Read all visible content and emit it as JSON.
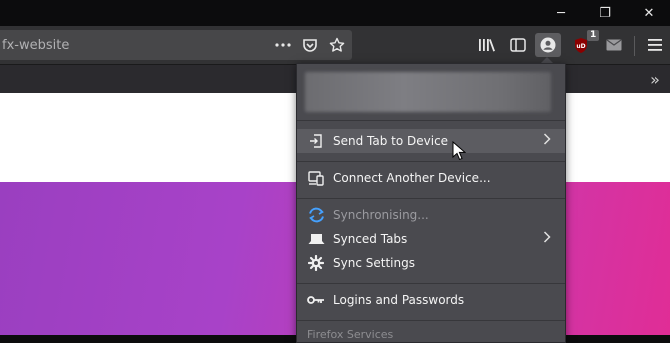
{
  "window": {
    "controls": {
      "minimize": "─",
      "restore": "❐",
      "close": "✕"
    }
  },
  "address_bar": {
    "url": "fx-website",
    "actions": [
      "page-actions-icon",
      "pocket-icon",
      "bookmark-star-icon"
    ]
  },
  "toolbar": {
    "icons": [
      "library-icon",
      "sidebar-icon",
      "account-icon",
      "ublock-icon",
      "email-icon",
      "menu-icon"
    ],
    "ublock_badge": "1",
    "overflow_glyph": "»"
  },
  "sync_panel": {
    "items": {
      "send_tab": "Send Tab to Device",
      "connect_device": "Connect Another Device...",
      "synchronising": "Synchronising...",
      "synced_tabs": "Synced Tabs",
      "sync_settings": "Sync Settings",
      "logins": "Logins and Passwords"
    },
    "footer_partial": "Firefox Services"
  },
  "colors": {
    "toolbar": "#323234",
    "panel": "#4a4a4f",
    "accent_sync": "#45a1ff",
    "hero_start": "#9a3fc0",
    "hero_end": "#e02d96"
  }
}
